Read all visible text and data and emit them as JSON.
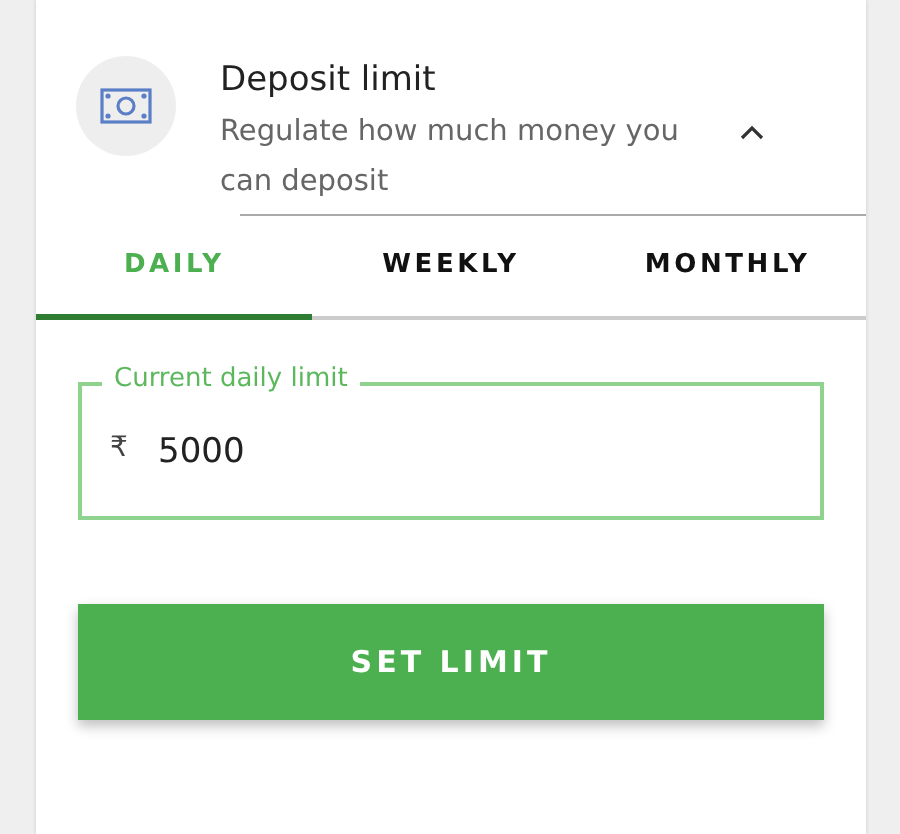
{
  "header": {
    "title": "Deposit limit",
    "subtitle": "Regulate how much money you can deposit",
    "expanded": true
  },
  "tabs": [
    {
      "label": "DAILY",
      "selected": true
    },
    {
      "label": "WEEKLY",
      "selected": false
    },
    {
      "label": "MONTHLY",
      "selected": false
    }
  ],
  "limit_field": {
    "label": "Current daily limit",
    "currency": "₹",
    "value": "5000"
  },
  "button": {
    "label": "SET LIMIT"
  }
}
